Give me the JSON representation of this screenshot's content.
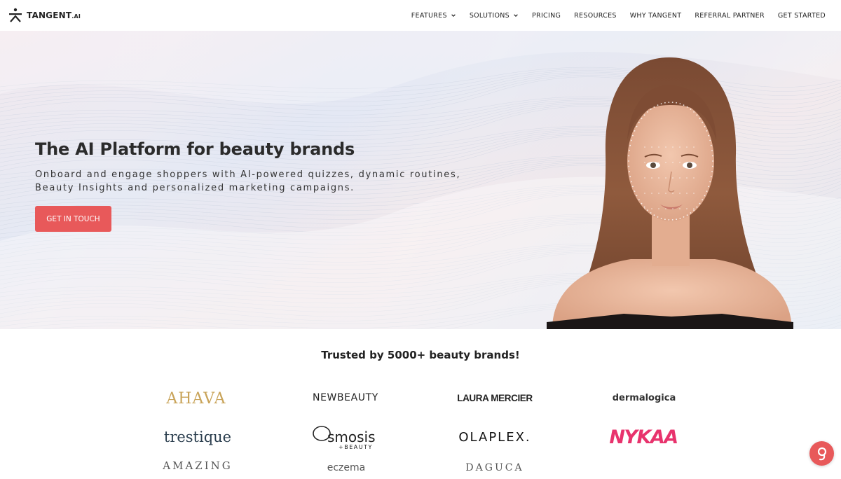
{
  "brand": {
    "name": "TANGENT",
    "suffix": ".AI"
  },
  "nav": {
    "items": [
      {
        "label": "FEATURES",
        "dropdown": true
      },
      {
        "label": "SOLUTIONS",
        "dropdown": true
      },
      {
        "label": "PRICING",
        "dropdown": false
      },
      {
        "label": "RESOURCES",
        "dropdown": false
      },
      {
        "label": "WHY TANGENT",
        "dropdown": false
      },
      {
        "label": "REFERRAL PARTNER",
        "dropdown": false
      },
      {
        "label": "GET STARTED",
        "dropdown": false
      }
    ]
  },
  "hero": {
    "title": "The AI Platform for beauty brands",
    "subtitle": "Onboard and engage shoppers with AI-powered quizzes, dynamic routines, Beauty Insights and personalized marketing campaigns.",
    "cta_label": "GET IN TOUCH"
  },
  "trusted": {
    "heading": "Trusted by 5000+ beauty brands!",
    "logos": [
      "AHAVA",
      "NEWBEAUTY",
      "LAURA MERCIER",
      "dermalogica",
      "trestique",
      "Osmosis +BEAUTY",
      "OLAPLEX.",
      "NYKAA",
      "AMAZING",
      "eczema",
      "DAGUCA"
    ]
  },
  "chat": {
    "icon": "chat-bubble-icon"
  },
  "colors": {
    "accent": "#e8595a",
    "ahava_gold": "#c9a45a",
    "nykaa_pink": "#e8336d",
    "trestique_navy": "#2c3f4f"
  }
}
